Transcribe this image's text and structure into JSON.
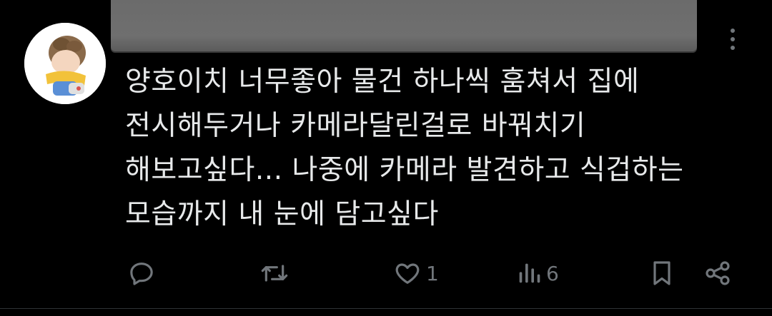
{
  "post": {
    "body_lines": "양호이치 너무좋아 물건 하나씩 훔쳐서 집에\n전시해두거나 카메라달린걸로 바꿔치기\n해보고싶다... 나중에 카메라 발견하고 식겁하는\n모습까지 내 눈에 담고싶다"
  },
  "actions": {
    "reply_icon": "reply-icon",
    "retweet_icon": "retweet-icon",
    "like_icon": "heart-icon",
    "like_count": "1",
    "views_icon": "views-icon",
    "views_count": "6",
    "bookmark_icon": "bookmark-icon",
    "share_icon": "share-icon"
  },
  "colors": {
    "background": "#000000",
    "text": "#e7e9ea",
    "muted": "#71767b",
    "redaction": "#6b6b6b"
  }
}
